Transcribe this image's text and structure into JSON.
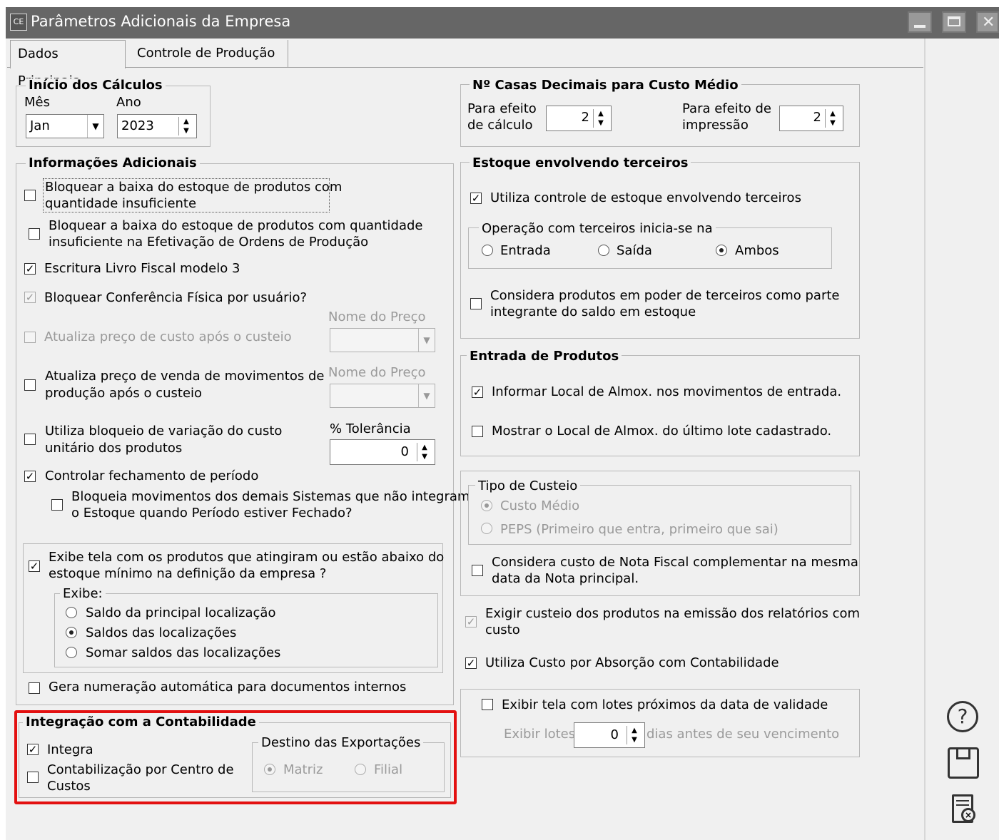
{
  "window": {
    "icon_text": "CE",
    "title": "Parâmetros Adicionais da Empresa"
  },
  "tabs": [
    {
      "label": "Dados Principais"
    },
    {
      "label": "Controle de Produção"
    }
  ],
  "inicio": {
    "legend": "Início dos Cálculos",
    "mes_label": "Mês",
    "mes_value": "Jan",
    "ano_label": "Ano",
    "ano_value": "2023"
  },
  "info": {
    "legend": "Informações Adicionais",
    "bloquear_baixa": {
      "line1": "Bloquear a baixa do estoque de produtos com",
      "line2": "quantidade insuficiente",
      "checked": false
    },
    "bloquear_ordens": {
      "line1": "Bloquear a baixa do estoque de produtos com quantidade",
      "line2": "insuficiente na Efetivação de Ordens de Produção",
      "checked": false
    },
    "escritura": {
      "label": "Escritura Livro Fiscal modelo 3",
      "checked": true
    },
    "conferencia": {
      "label": "Bloquear Conferência Física por usuário?",
      "checked": true
    },
    "nome_preco_label_1": "Nome do Preço",
    "atualiza_custo": {
      "label": "Atualiza preço de custo após o custeio",
      "checked": false
    },
    "nome_preco_label_2": "Nome do Preço",
    "atualiza_venda": {
      "line1": "Atualiza preço de venda de movimentos de",
      "line2": "produção após o custeio",
      "checked": false
    },
    "tolerancia_label": "% Tolerância",
    "tolerancia_value": "0",
    "variacao": {
      "line1": "Utiliza bloqueio de variação do custo",
      "line2": "unitário dos produtos",
      "checked": false
    },
    "fechamento": {
      "label": "Controlar fechamento de período",
      "checked": true
    },
    "bloqueia_mov": {
      "line1": "Bloqueia movimentos dos demais Sistemas que não integram",
      "line2": "o Estoque quando Período estiver Fechado?",
      "checked": false
    },
    "exibe_tela": {
      "line1": "Exibe tela com os produtos que atingiram ou estão abaixo do",
      "line2": "estoque mínimo na definição da empresa ?",
      "checked": true
    },
    "exibe_legend": "Exibe:",
    "exibe_options": [
      "Saldo da principal localização",
      "Saldos das localizações",
      "Somar saldos das localizações"
    ],
    "gera_numeracao": {
      "label": "Gera numeração automática para documentos internos",
      "checked": false
    }
  },
  "integracao": {
    "legend": "Integração com a Contabilidade",
    "integra": {
      "label": "Integra",
      "checked": true
    },
    "centro": {
      "line1": "Contabilização por Centro de",
      "line2": "Custos",
      "checked": false
    },
    "destino_legend": "Destino das Exportações",
    "matriz": "Matriz",
    "filial": "Filial"
  },
  "casas": {
    "legend": "Nº Casas Decimais para Custo Médio",
    "calculo_line1": "Para efeito",
    "calculo_line2": "de cálculo",
    "calculo_value": "2",
    "impressao_line1": "Para efeito de",
    "impressao_line2": "impressão",
    "impressao_value": "2"
  },
  "terceiros": {
    "legend": "Estoque envolvendo terceiros",
    "utiliza": {
      "label": "Utiliza controle de estoque envolvendo terceiros",
      "checked": true
    },
    "operacao_legend": "Operação com terceiros inicia-se na",
    "entrada": "Entrada",
    "saida": "Saída",
    "ambos": "Ambos",
    "considera": {
      "line1": "Considera produtos em poder de terceiros como parte",
      "line2": "integrante do saldo em estoque",
      "checked": false
    }
  },
  "entrada": {
    "legend": "Entrada de Produtos",
    "informar": {
      "label": "Informar Local de Almox. nos movimentos de entrada.",
      "checked": true
    },
    "mostrar": {
      "label": "Mostrar o Local de Almox. do último lote cadastrado.",
      "checked": false
    }
  },
  "custeio": {
    "legend": "Tipo de Custeio",
    "medio": "Custo Médio",
    "peps": "PEPS (Primeiro que entra, primeiro que sai)",
    "complementar": {
      "line1": "Considera custo de Nota Fiscal complementar na mesma",
      "line2": "data da Nota principal.",
      "checked": false
    }
  },
  "exigir": {
    "line1": "Exigir custeio dos produtos na emissão dos relatórios com",
    "line2": "custo",
    "checked": true
  },
  "absorcao": {
    "label": "Utiliza Custo por Absorção com Contabilidade",
    "checked": true
  },
  "lotes": {
    "exibir": {
      "label": "Exibir tela com lotes próximos da data de validade",
      "checked": false
    },
    "prefix": "Exibir lotes",
    "value": "0",
    "suffix": "dias antes de seu vencimento"
  },
  "colors": {
    "highlight": "#e31010",
    "titlebar": "#666666"
  }
}
